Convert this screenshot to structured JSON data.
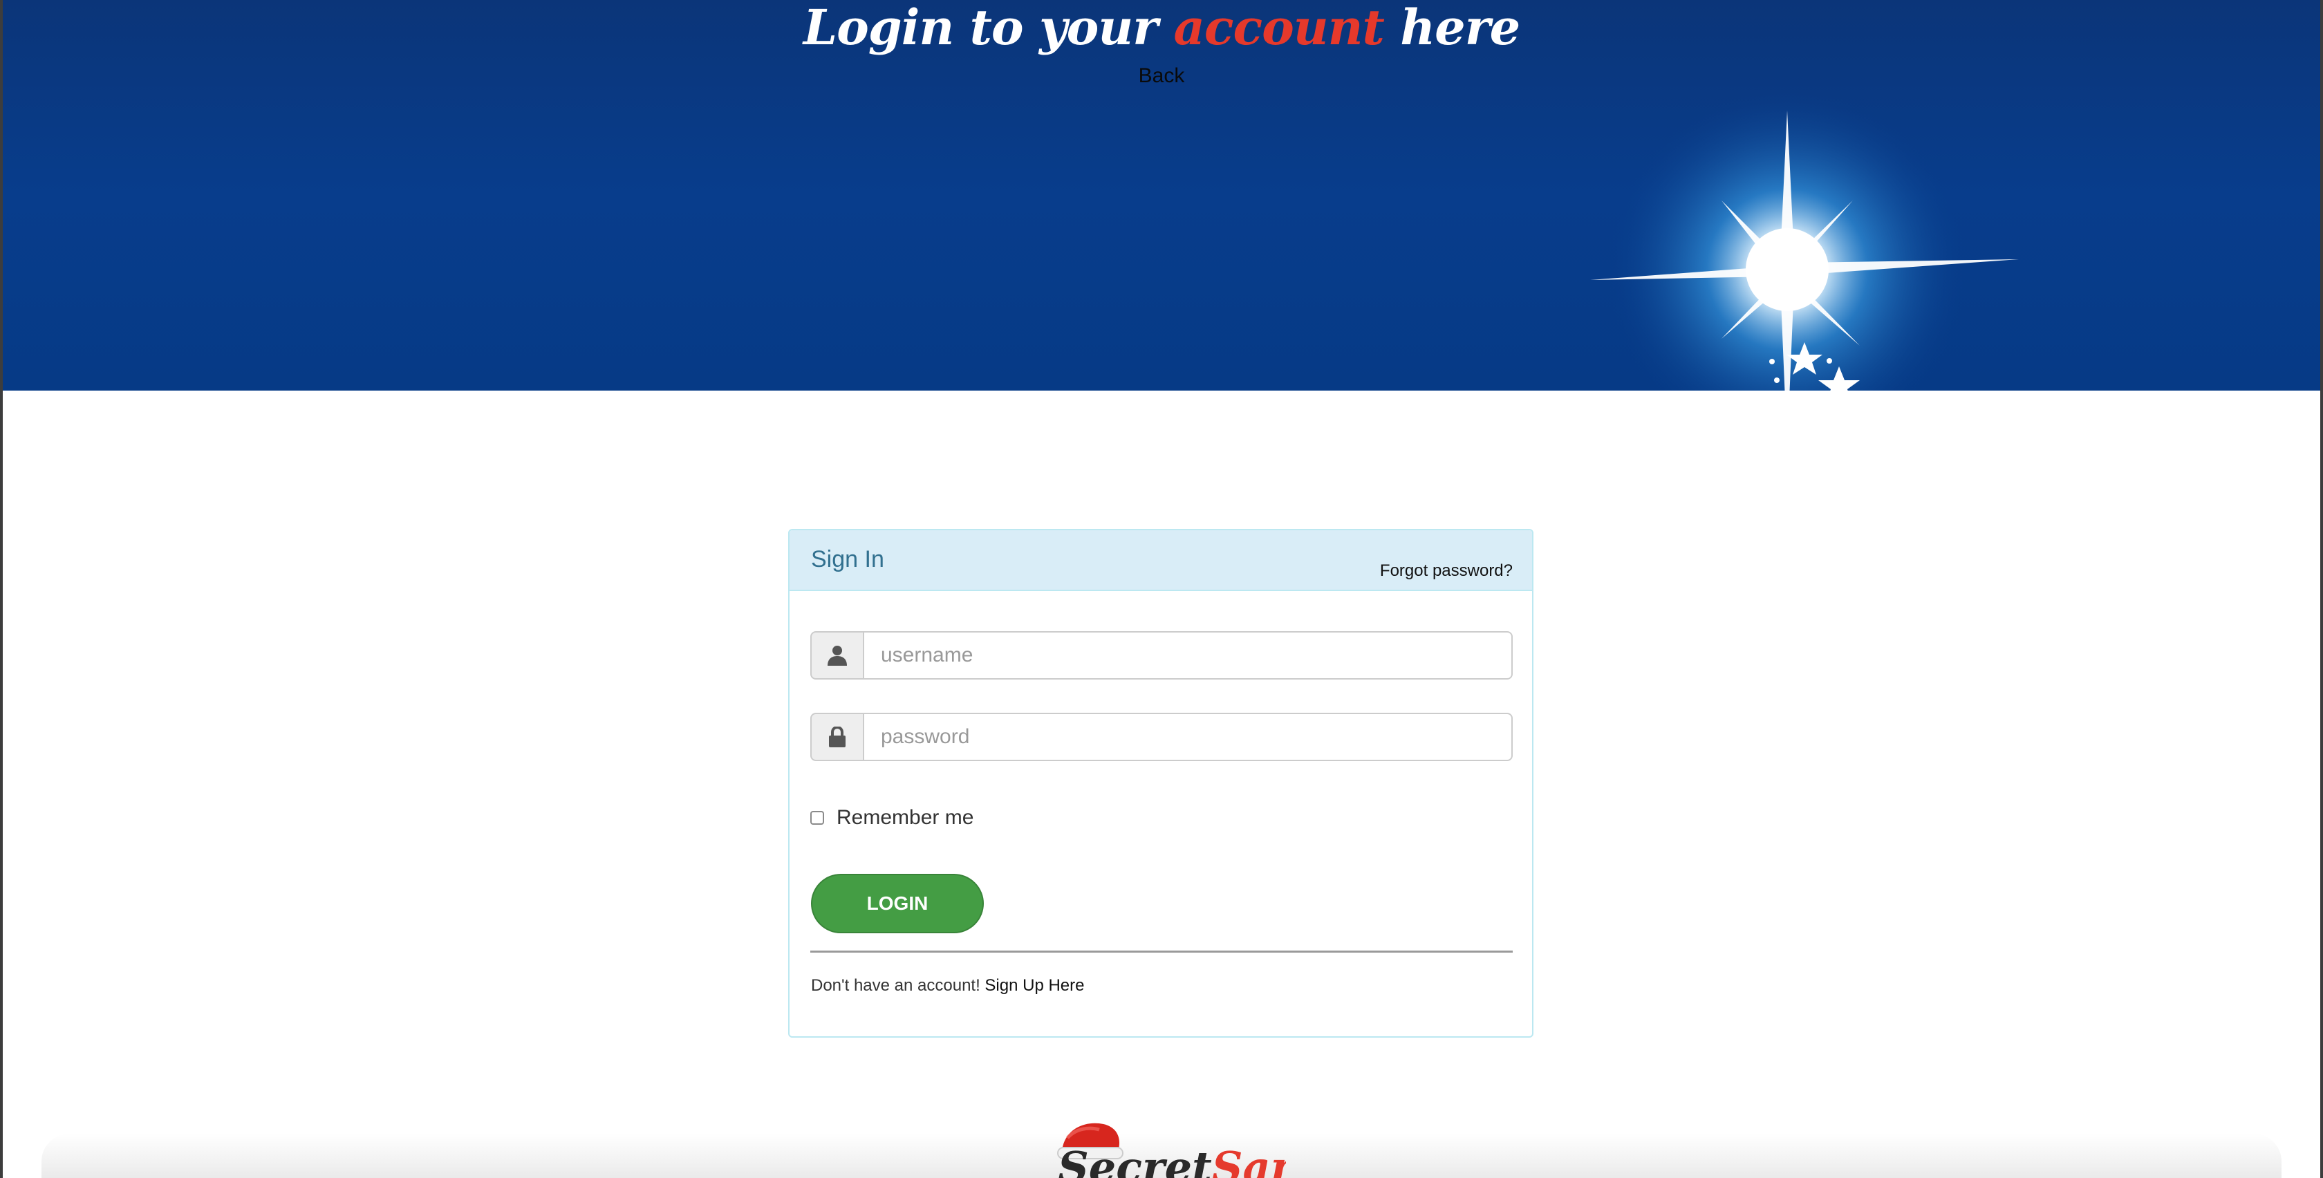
{
  "header": {
    "title_part1": "Login to your ",
    "title_accent": "account",
    "title_part2": " here",
    "back_label": "Back"
  },
  "panel": {
    "title": "Sign In",
    "forgot_label": "Forgot password?",
    "username_placeholder": "username",
    "password_placeholder": "password",
    "remember_label": "Remember me",
    "login_label": "LOGIN",
    "signup_text": "Don't have an account! ",
    "signup_link": "Sign Up Here"
  },
  "footer": {
    "logo_word1": "Secret",
    "logo_word2": "Santa"
  },
  "icons": {
    "username": "user-icon",
    "password": "lock-icon",
    "logo_hat": "santa-hat-icon"
  },
  "colors": {
    "hero_blue": "#083d8c",
    "accent_red": "#e6392b",
    "panel_heading_bg": "#d9edf7",
    "panel_border": "#bce8f1",
    "login_green": "#449d44"
  }
}
